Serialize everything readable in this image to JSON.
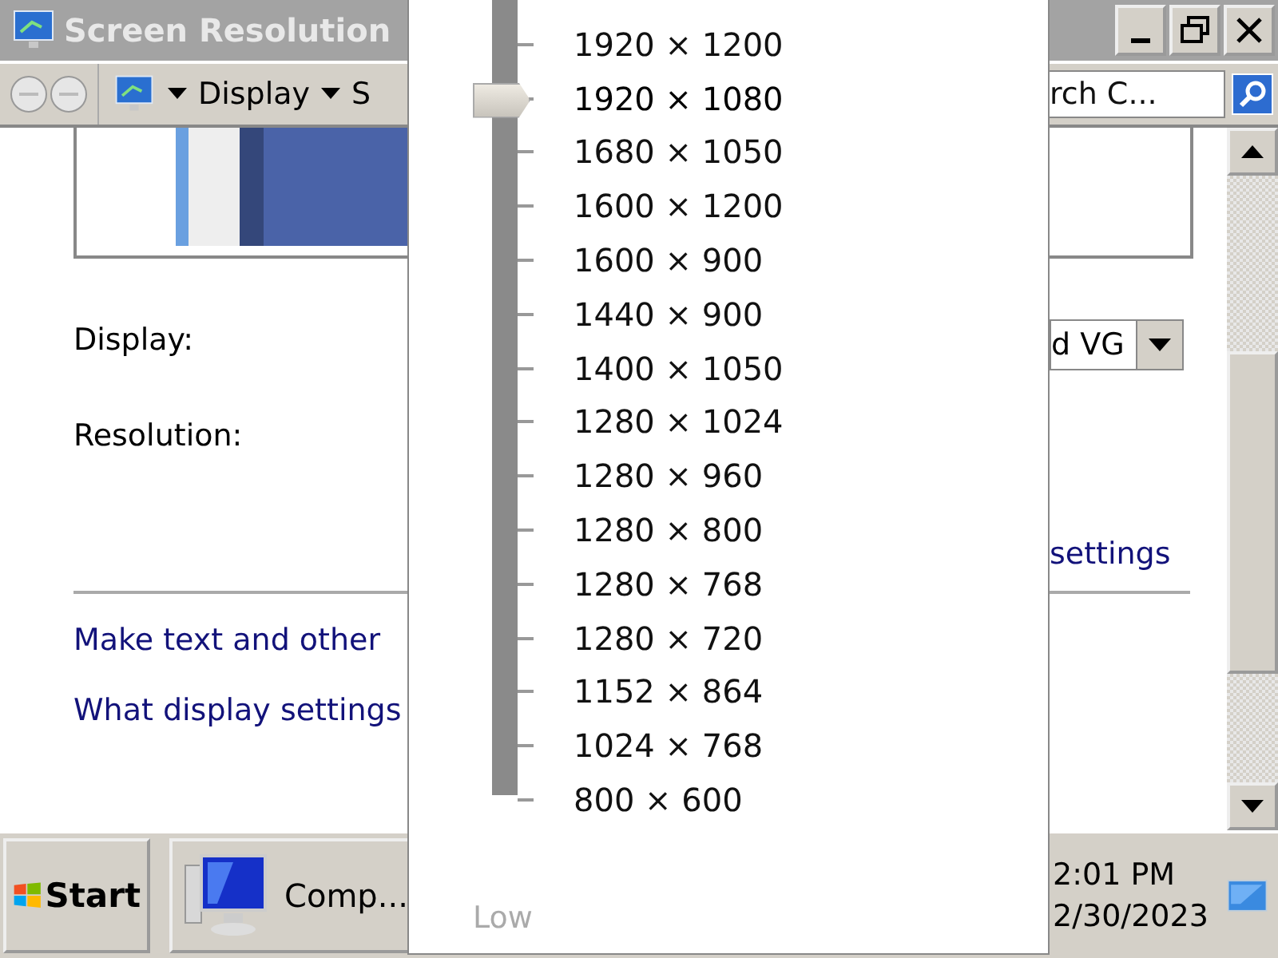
{
  "window": {
    "title": "Screen Resolution"
  },
  "toolbar": {
    "breadcrumbs": [
      "Display",
      "S"
    ],
    "search": {
      "placeholder": "rch C..."
    }
  },
  "form": {
    "display_label": "Display:",
    "display_value": "d VG",
    "resolution_label": "Resolution:",
    "advanced_link": "settings"
  },
  "links": [
    "Make text and other",
    "What display settings"
  ],
  "resolution_popup": {
    "options": [
      {
        "label": "1920 × 1200",
        "selected": false
      },
      {
        "label": "1920 × 1080",
        "selected": true
      },
      {
        "label": "1680 × 1050",
        "selected": false
      },
      {
        "label": "1600 × 1200",
        "selected": false
      },
      {
        "label": "1600 × 900",
        "selected": false
      },
      {
        "label": "1440 × 900",
        "selected": false
      },
      {
        "label": "1400 × 1050",
        "selected": false
      },
      {
        "label": "1280 × 1024",
        "selected": false
      },
      {
        "label": "1280 × 960",
        "selected": false
      },
      {
        "label": "1280 × 800",
        "selected": false
      },
      {
        "label": "1280 × 768",
        "selected": false
      },
      {
        "label": "1280 × 720",
        "selected": false
      },
      {
        "label": "1152 × 864",
        "selected": false
      },
      {
        "label": "1024 × 768",
        "selected": false
      },
      {
        "label": "800 × 600",
        "selected": false
      }
    ],
    "low_label": "Low"
  },
  "taskbar": {
    "start": "Start",
    "tasks": [
      {
        "label": "Comp..."
      }
    ],
    "clock": {
      "time": "2:01 PM",
      "date": "2/30/2023"
    }
  }
}
